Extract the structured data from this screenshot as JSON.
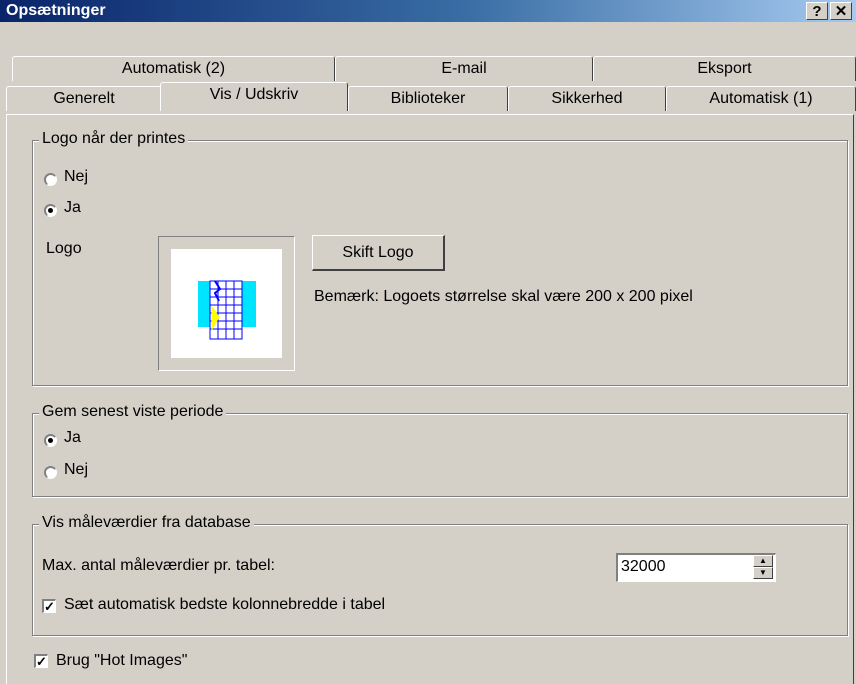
{
  "window": {
    "title": "Opsætninger",
    "help_label": "?",
    "close_label": "✕"
  },
  "tabs_row1": [
    {
      "label": "Automatisk (2)"
    },
    {
      "label": "E-mail"
    },
    {
      "label": "Eksport"
    }
  ],
  "tabs_row2": [
    {
      "label": "Generelt"
    },
    {
      "label": "Vis / Udskriv",
      "active": true
    },
    {
      "label": "Biblioteker"
    },
    {
      "label": "Sikkerhed"
    },
    {
      "label": "Automatisk (1)"
    }
  ],
  "logo_group": {
    "legend": "Logo når der printes",
    "options": [
      {
        "label": "Nej",
        "selected": false
      },
      {
        "label": "Ja",
        "selected": true
      }
    ],
    "logo_label": "Logo",
    "change_button": "Skift Logo",
    "note": "Bemærk: Logoets størrelse skal være 200 x 200 pixel"
  },
  "period_group": {
    "legend": "Gem senest viste periode",
    "options": [
      {
        "label": "Ja",
        "selected": true
      },
      {
        "label": "Nej",
        "selected": false
      }
    ]
  },
  "db_group": {
    "legend": "Vis måleværdier fra database",
    "max_label": "Max. antal måleværdier pr. tabel:",
    "max_value": "32000",
    "autowidth_label": "Sæt automatisk bedste kolonnebredde i tabel",
    "autowidth_checked": true
  },
  "hot_images": {
    "label": "Brug \"Hot Images\"",
    "checked": true
  },
  "colors": {
    "titlebar_start": "#0a246a",
    "face": "#d4d0c8",
    "logo_cyan": "#00e5ff",
    "logo_blue": "#0000ff",
    "logo_yellow": "#ffff00"
  }
}
